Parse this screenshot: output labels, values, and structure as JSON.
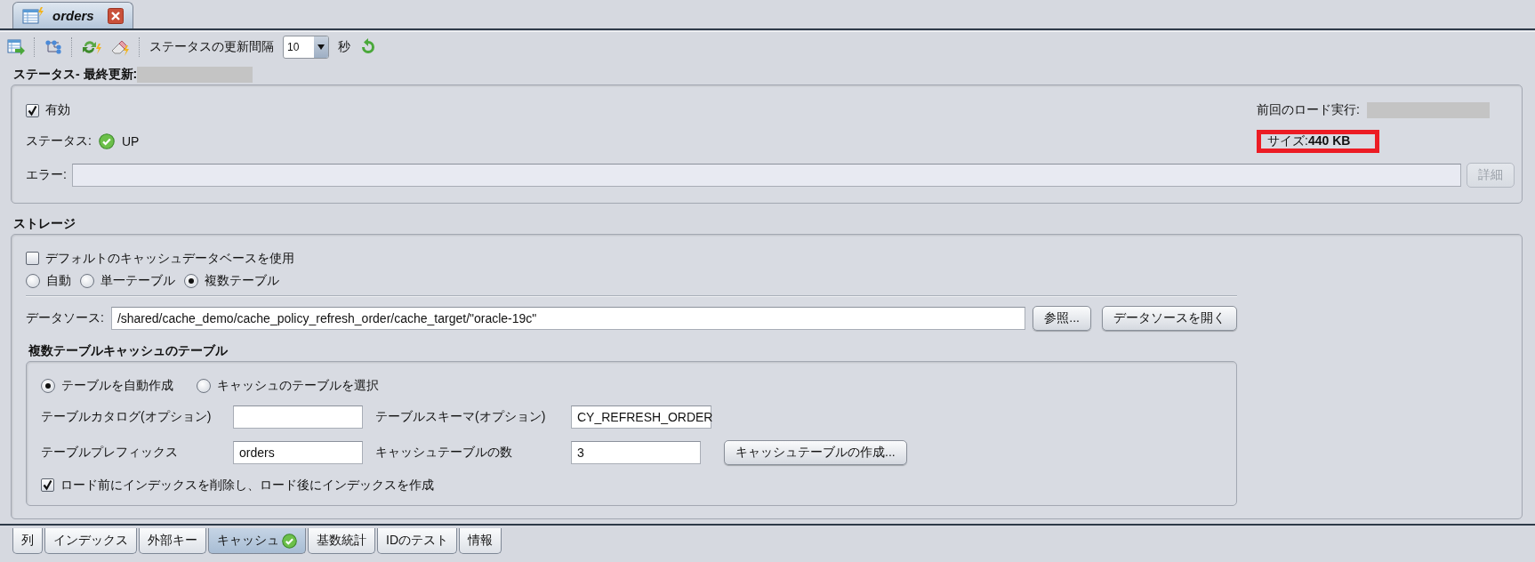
{
  "document_tab": {
    "title": "orders",
    "selected": true
  },
  "toolbar": {
    "refresh_label": "ステータスの更新間隔",
    "interval": "10",
    "unit": "秒"
  },
  "status": {
    "title": "ステータス- 最終更新:",
    "enabled": {
      "label": "有効",
      "checked": true
    },
    "status_label": "ステータス:",
    "status_value": "UP",
    "status_ok": true,
    "last_load_label": "前回のロード実行:",
    "size": "サイズ:**440 KB**",
    "size_highlighted": true,
    "error_label": "エラー:",
    "details_button": {
      "label": "詳細",
      "disabled": true
    }
  },
  "storage": {
    "title": "ストレージ",
    "use_default_db": {
      "label": "デフォルトのキャッシュデータベースを使用",
      "checked": false
    },
    "modes": [
      {
        "label": "自動",
        "selected": false
      },
      {
        "label": "単一テーブル",
        "selected": false
      },
      {
        "label": "複数テーブル",
        "selected": true
      }
    ],
    "datasource_label": "データソース:",
    "datasource_value": "/shared/cache_demo/cache_policy_refresh_order/cache_target/\"oracle-19c\"",
    "buttons": [
      {
        "label": "参照...",
        "disabled": false
      },
      {
        "label": "データソースを開く",
        "disabled": false
      }
    ],
    "multi_table": {
      "title": "複数テーブルキャッシュのテーブル",
      "options": [
        {
          "label": "テーブルを自動作成",
          "selected": true
        },
        {
          "label": "キャッシュのテーブルを選択",
          "selected": false
        }
      ],
      "catalog_label": "テーブルカタログ(オプション)",
      "schema_label": "テーブルスキーマ(オプション)",
      "schema_value": "CY_REFRESH_ORDER",
      "prefix_label": "テーブルプレフィックス",
      "prefix_value": "orders",
      "count_label": "キャッシュテーブルの数",
      "count_value": "3",
      "create_button": {
        "label": "キャッシュテーブルの作成...",
        "disabled": false
      },
      "drop_indexes": {
        "label": "ロード前にインデックスを削除し、ロード後にインデックスを作成",
        "checked": true
      }
    }
  },
  "bottom_tabs": [
    {
      "label": "列",
      "selected": false,
      "status_ok": false
    },
    {
      "label": "インデックス",
      "selected": false,
      "status_ok": false
    },
    {
      "label": "外部キー",
      "selected": false,
      "status_ok": false
    },
    {
      "label": "キャッシュ",
      "selected": true,
      "status_ok": true
    },
    {
      "label": "基数統計",
      "selected": false,
      "status_ok": false
    },
    {
      "label": "IDのテスト",
      "selected": false,
      "status_ok": false
    },
    {
      "label": "情報",
      "selected": false,
      "status_ok": false
    }
  ]
}
